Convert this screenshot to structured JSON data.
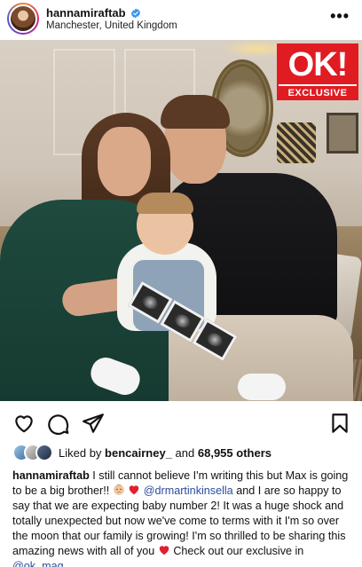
{
  "header": {
    "username": "hannamiraftab",
    "location": "Manchester, United Kingdom",
    "more_label": "•••"
  },
  "photo": {
    "badge_logo": "OK!",
    "badge_label": "EXCLUSIVE"
  },
  "actions": {
    "like_icon": "heart-icon",
    "comment_icon": "comment-icon",
    "share_icon": "send-icon",
    "save_icon": "bookmark-icon"
  },
  "likes": {
    "prefix": "Liked by",
    "user": "bencairney_",
    "conjunction": "and",
    "count": "68,955 others"
  },
  "caption": {
    "username": "hannamiraftab",
    "part1": "I still cannot believe I'm writing this but Max is going to be a big brother!!",
    "mention1": "@drmartinkinsella",
    "part2": "and I are so happy to say that we are expecting baby number 2! It was a huge shock and totally unexpected but now we've come to terms with it I'm so over the moon that our family is growing! I'm so thrilled to be sharing this amazing news with all of you",
    "part3": "Check out our exclusive in",
    "mention2": "@ok_mag"
  },
  "colors": {
    "brand_red": "#e11b22",
    "mention_blue": "#2b4c9a",
    "verified_blue": "#3897f0"
  }
}
